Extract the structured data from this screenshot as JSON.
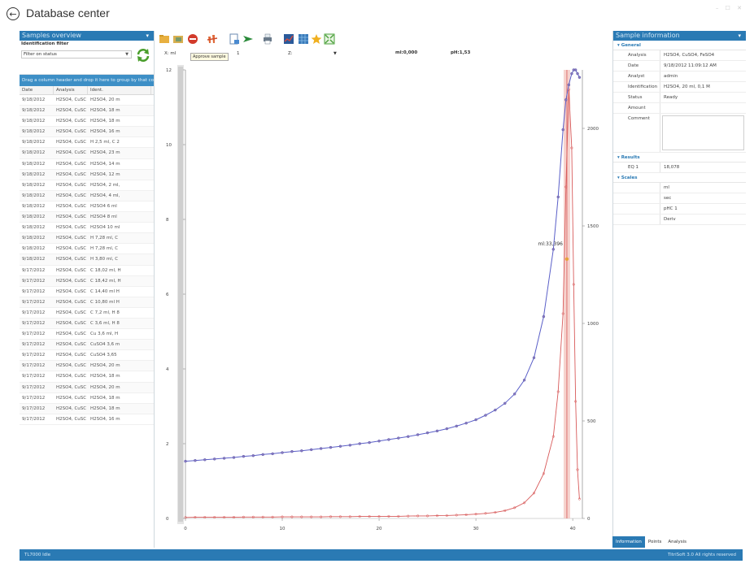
{
  "window": {
    "title": "Database center",
    "controls": "– ☐ ✕"
  },
  "left_panel": {
    "header": "Samples overview",
    "filter_title": "Identification filter",
    "filter_value": "Filter on status",
    "drag_hint": "Drag a column header and drop it here to group by that column",
    "columns": [
      "Date",
      "Analysis",
      "Ident."
    ],
    "rows": [
      [
        "9/18/2012",
        "H2SO4, CuSC",
        "H2SO4, 20 m"
      ],
      [
        "9/18/2012",
        "H2SO4, CuSC",
        "H2SO4, 18 m"
      ],
      [
        "9/18/2012",
        "H2SO4, CuSC",
        "H2SO4, 18 m"
      ],
      [
        "9/18/2012",
        "H2SO4, CuSC",
        "H2SO4, 16 m"
      ],
      [
        "9/18/2012",
        "H2SO4, CuSC",
        "H 2,5 ml, C 2"
      ],
      [
        "9/18/2012",
        "H2SO4, CuSC",
        "H2SO4, 23 m"
      ],
      [
        "9/18/2012",
        "H2SO4, CuSC",
        "H2SO4, 14 m"
      ],
      [
        "9/18/2012",
        "H2SO4, CuSC",
        "H2SO4, 12 m"
      ],
      [
        "9/18/2012",
        "H2SO4, CuSC",
        "H2SO4, 2 ml,"
      ],
      [
        "9/18/2012",
        "H2SO4, CuSC",
        "H2SO4, 4 ml,"
      ],
      [
        "9/18/2012",
        "H2SO4, CuSC",
        "H2SO4 6 ml"
      ],
      [
        "9/18/2012",
        "H2SO4, CuSC",
        "H2SO4 8 ml"
      ],
      [
        "9/18/2012",
        "H2SO4, CuSC",
        "H2SO4 10 ml"
      ],
      [
        "9/18/2012",
        "H2SO4, CuSC",
        "H 7,28 ml, C"
      ],
      [
        "9/18/2012",
        "H2SO4, CuSC",
        "H 7,28 ml, C"
      ],
      [
        "9/18/2012",
        "H2SO4, CuSC",
        "H 3,80 ml, C"
      ],
      [
        "9/17/2012",
        "H2SO4, CuSC",
        "C 18,02 ml, H"
      ],
      [
        "9/17/2012",
        "H2SO4, CuSC",
        "C 18,42 ml, H"
      ],
      [
        "9/17/2012",
        "H2SO4, CuSC",
        "C 14,40 ml H"
      ],
      [
        "9/17/2012",
        "H2SO4, CuSC",
        "C 10,80 ml H"
      ],
      [
        "9/17/2012",
        "H2SO4, CuSC",
        "C 7,2 ml, H 8"
      ],
      [
        "9/17/2012",
        "H2SO4, CuSC",
        "C 3,6 ml, H 8"
      ],
      [
        "9/17/2012",
        "H2SO4, CuSC",
        "Cu 3,6 ml, H"
      ],
      [
        "9/17/2012",
        "H2SO4, CuSC",
        "CuSO4 3,6 m"
      ],
      [
        "9/17/2012",
        "H2SO4, CuSC",
        "CuSO4 3,65"
      ],
      [
        "9/17/2012",
        "H2SO4, CuSC",
        "H2SO4, 20 m"
      ],
      [
        "9/17/2012",
        "H2SO4, CuSC",
        "H2SO4, 18 m"
      ],
      [
        "9/17/2012",
        "H2SO4, CuSC",
        "H2SO4, 20 m"
      ],
      [
        "9/17/2012",
        "H2SO4, CuSC",
        "H2SO4, 18 m"
      ],
      [
        "9/17/2012",
        "H2SO4, CuSC",
        "H2SO4, 18 m"
      ],
      [
        "9/17/2012",
        "H2SO4, CuSC",
        "H2SO4, 16 m"
      ]
    ]
  },
  "toolbar": {
    "tooltip": "Approve sample",
    "curve_prefix": "X: ml",
    "curve_mid": "Z:",
    "readout_1": "ml:0,000",
    "readout_2": "pH:1,53",
    "y1_field": "1"
  },
  "chart": {
    "left_axis_ticks": [
      "12",
      "10",
      "8",
      "6",
      "4",
      "2",
      "0"
    ],
    "right_axis_ticks": [
      "2000",
      "1500",
      "1000",
      "500",
      "0"
    ],
    "x_ticks": [
      "0",
      "10",
      "20",
      "30",
      "40"
    ],
    "ep_label": "ml:33,396",
    "colors": {
      "curve": "#5a5fc8",
      "curve_marker": "#8a7ac0",
      "derivative": "#d85a5a",
      "ep_band": "#f3c4bd",
      "ep_marker": "#e8a23a"
    }
  },
  "chart_data": {
    "type": "line",
    "title": "",
    "xlabel": "",
    "ylabel": "",
    "xlim": [
      0,
      41
    ],
    "ylim": [
      0,
      12
    ],
    "y2lim": [
      0,
      2300
    ],
    "series": [
      {
        "axis": "left",
        "x": [
          0,
          1,
          2,
          3,
          4,
          5,
          6,
          7,
          8,
          9,
          10,
          11,
          12,
          13,
          14,
          15,
          16,
          17,
          18,
          19,
          20,
          21,
          22,
          23,
          24,
          25,
          26,
          27,
          28,
          29,
          30,
          31,
          32,
          33,
          34,
          35,
          36,
          37,
          38,
          38.5,
          39,
          39.3,
          39.6,
          39.9,
          40.1,
          40.3,
          40.5,
          40.7
        ],
        "values": [
          1.53,
          1.55,
          1.57,
          1.59,
          1.61,
          1.63,
          1.66,
          1.68,
          1.71,
          1.73,
          1.76,
          1.79,
          1.81,
          1.84,
          1.87,
          1.9,
          1.93,
          1.96,
          2.0,
          2.03,
          2.07,
          2.11,
          2.15,
          2.19,
          2.24,
          2.29,
          2.34,
          2.4,
          2.47,
          2.55,
          2.64,
          2.76,
          2.9,
          3.08,
          3.33,
          3.7,
          4.3,
          5.4,
          7.2,
          8.6,
          10.4,
          11.2,
          11.6,
          11.9,
          12.0,
          12.0,
          11.9,
          11.8
        ]
      },
      {
        "axis": "right",
        "x": [
          0,
          1,
          2,
          3,
          4,
          5,
          6,
          7,
          8,
          9,
          10,
          11,
          12,
          13,
          14,
          15,
          16,
          17,
          18,
          19,
          20,
          21,
          22,
          23,
          24,
          25,
          26,
          27,
          28,
          29,
          30,
          31,
          32,
          33,
          34,
          35,
          36,
          37,
          38,
          38.5,
          39,
          39.3,
          39.6,
          39.9,
          40.1,
          40.3,
          40.5,
          40.7
        ],
        "values": [
          5,
          6,
          6,
          6,
          6,
          6,
          7,
          7,
          7,
          7,
          8,
          8,
          8,
          8,
          8,
          9,
          9,
          9,
          10,
          10,
          10,
          11,
          11,
          12,
          13,
          13,
          14,
          15,
          17,
          19,
          22,
          26,
          31,
          40,
          55,
          80,
          130,
          230,
          420,
          650,
          1050,
          1700,
          2200,
          1900,
          1200,
          600,
          250,
          100
        ]
      }
    ],
    "endpoint": {
      "x": 39.4,
      "label": "ml:33,396"
    },
    "grid": false,
    "legend": "none"
  },
  "right_panel": {
    "header": "Sample information",
    "general_label": "General",
    "props": [
      {
        "k": "Analysis",
        "v": "H2SO4, CuSO4, FeSO4"
      },
      {
        "k": "Date",
        "v": "9/18/2012 11:09:12 AM"
      },
      {
        "k": "Analyst",
        "v": "admin"
      },
      {
        "k": "Identification",
        "v": "H2SO4, 20 ml, 0,1 M"
      },
      {
        "k": "Status",
        "v": "Ready"
      },
      {
        "k": "Amount",
        "v": ""
      },
      {
        "k": "Comment",
        "v": ""
      }
    ],
    "results_label": "Results",
    "results": [
      {
        "k": "EQ 1",
        "v": "18,078"
      }
    ],
    "scales_label": "Scales",
    "scales": [
      "ml",
      "sec",
      "pHC 1",
      "Deriv"
    ],
    "tabs": [
      "Information",
      "Points",
      "Analysis"
    ]
  },
  "statusbar": {
    "left": "TL7000 Idle",
    "right": "TitriSoft 3.0 All rights reserved"
  }
}
